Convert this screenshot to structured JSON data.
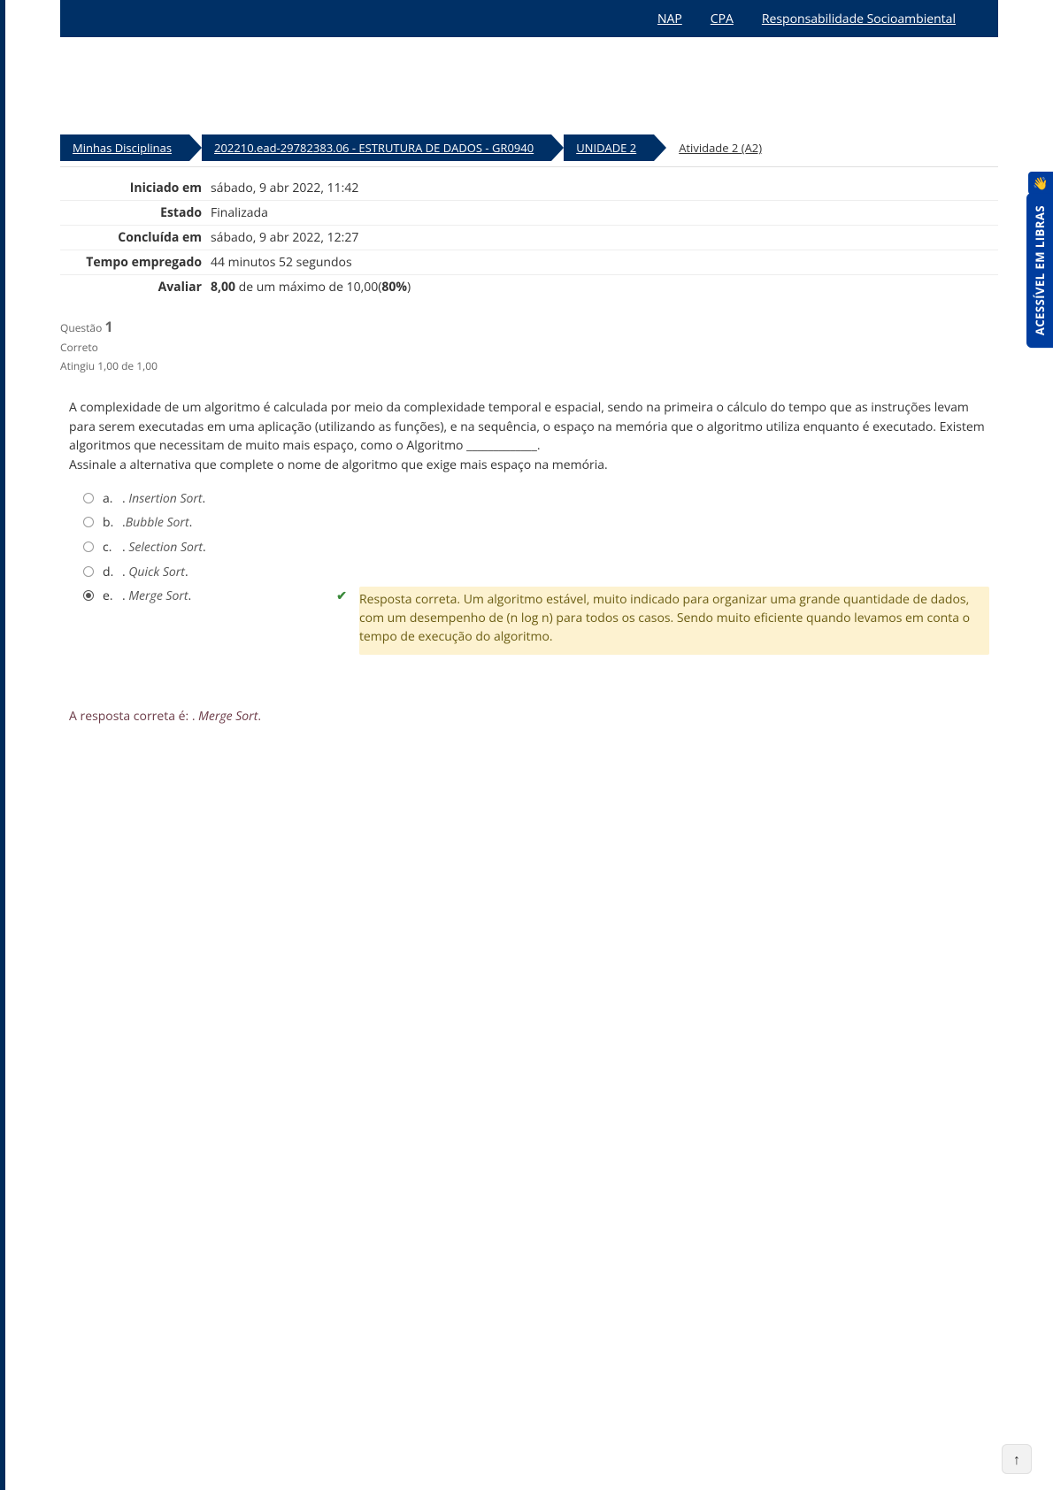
{
  "topNav": {
    "links": [
      "NAP",
      "CPA",
      "Responsabilidade Socioambiental"
    ]
  },
  "breadcrumb": {
    "items": [
      "Minhas Disciplinas",
      "202210.ead-29782383.06 - ESTRUTURA DE DADOS - GR0940",
      "UNIDADE 2",
      "Atividade 2 (A2)"
    ]
  },
  "review": {
    "labels": {
      "startedOn": "Iniciado em",
      "state": "Estado",
      "completedOn": "Concluída em",
      "timeTaken": "Tempo empregado",
      "grade": "Avaliar"
    },
    "values": {
      "startedOn": "sábado, 9 abr 2022, 11:42",
      "state": "Finalizada",
      "completedOn": "sábado, 9 abr 2022, 12:27",
      "timeTaken": "44 minutos 52 segundos",
      "gradeScore": "8,00",
      "gradeMid": " de um máximo de 10,00(",
      "gradePercent": "80%",
      "gradeEnd": ")"
    }
  },
  "question": {
    "label": "Questão",
    "number": "1",
    "statusCorrect": "Correto",
    "mark": "Atingiu 1,00 de 1,00",
    "stem": "A complexidade de um algoritmo é calculada por meio da complexidade temporal e espacial, sendo na primeira o cálculo do tempo que as instruções levam para serem executadas em uma aplicação (utilizando as funções), e na sequência, o espaço na memória que o algoritmo utiliza enquanto é executado. Existem algoritmos que necessitam de muito mais espaço, como o Algoritmo _____________.",
    "stem2": "Assinale a alternativa que complete o nome de algoritmo que exige mais espaço na memória.",
    "options": {
      "a": {
        "letter": "a.",
        "prefix": " . ",
        "text": "Insertion Sort",
        "suffix": "."
      },
      "b": {
        "letter": "b.",
        "prefix": " .",
        "text": "Bubble Sort",
        "suffix": "."
      },
      "c": {
        "letter": "c.",
        "prefix": " . ",
        "text": "Selection Sort",
        "suffix": "."
      },
      "d": {
        "letter": "d.",
        "prefix": " . ",
        "text": "Quick Sort",
        "suffix": "."
      },
      "e": {
        "letter": "e.",
        "prefix": " . ",
        "text": "Merge Sort",
        "suffix": "."
      }
    },
    "feedback": "Resposta correta. Um algoritmo estável, muito indicado para organizar uma grande quantidade de dados, com um desempenho de (n log n) para todos os casos. Sendo muito eficiente quando levamos em conta o tempo de execução do algoritmo.",
    "correctIntro": "A resposta correta é: . ",
    "correctAnswer": "Merge Sort",
    "correctSuffix": "."
  },
  "sideTab": {
    "label": "ACESSÍVEL EM LIBRAS",
    "iconGlyph": "👋"
  },
  "icons": {
    "check": "✔",
    "arrowUp": "↑"
  }
}
